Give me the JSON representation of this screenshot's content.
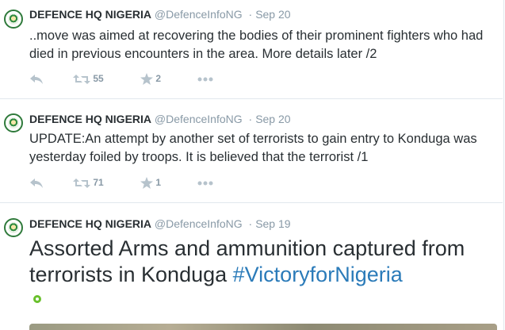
{
  "tweets": [
    {
      "name": "DEFENCE HQ NIGERIA",
      "handle": "@DefenceInfoNG",
      "separator": "·",
      "date": "Sep 20",
      "text": "..move was aimed at recovering the bodies of their prominent fighters who had died in previous encounters in the area. More details later /2",
      "retweets": "55",
      "favorites": "2"
    },
    {
      "name": "DEFENCE HQ NIGERIA",
      "handle": "@DefenceInfoNG",
      "separator": "·",
      "date": "Sep 20",
      "text": "UPDATE:An attempt by another set of terrorists to gain entry to Konduga was yesterday foiled by troops. It is believed that the terrorist /1",
      "retweets": "71",
      "favorites": "1"
    },
    {
      "name": "DEFENCE HQ NIGERIA",
      "handle": "@DefenceInfoNG",
      "separator": "·",
      "date": "Sep 19",
      "text": "Assorted Arms and ammunition captured from terrorists in Konduga ",
      "hashtag": "#VictoryforNigeria"
    }
  ],
  "colors": {
    "link": "#2b7bb9",
    "meta": "#8899a6",
    "text": "#292f33",
    "divider": "#e1e8ed"
  },
  "icons": [
    "reply-icon",
    "retweet-icon",
    "star-icon",
    "more-icon",
    "photo-icon"
  ]
}
